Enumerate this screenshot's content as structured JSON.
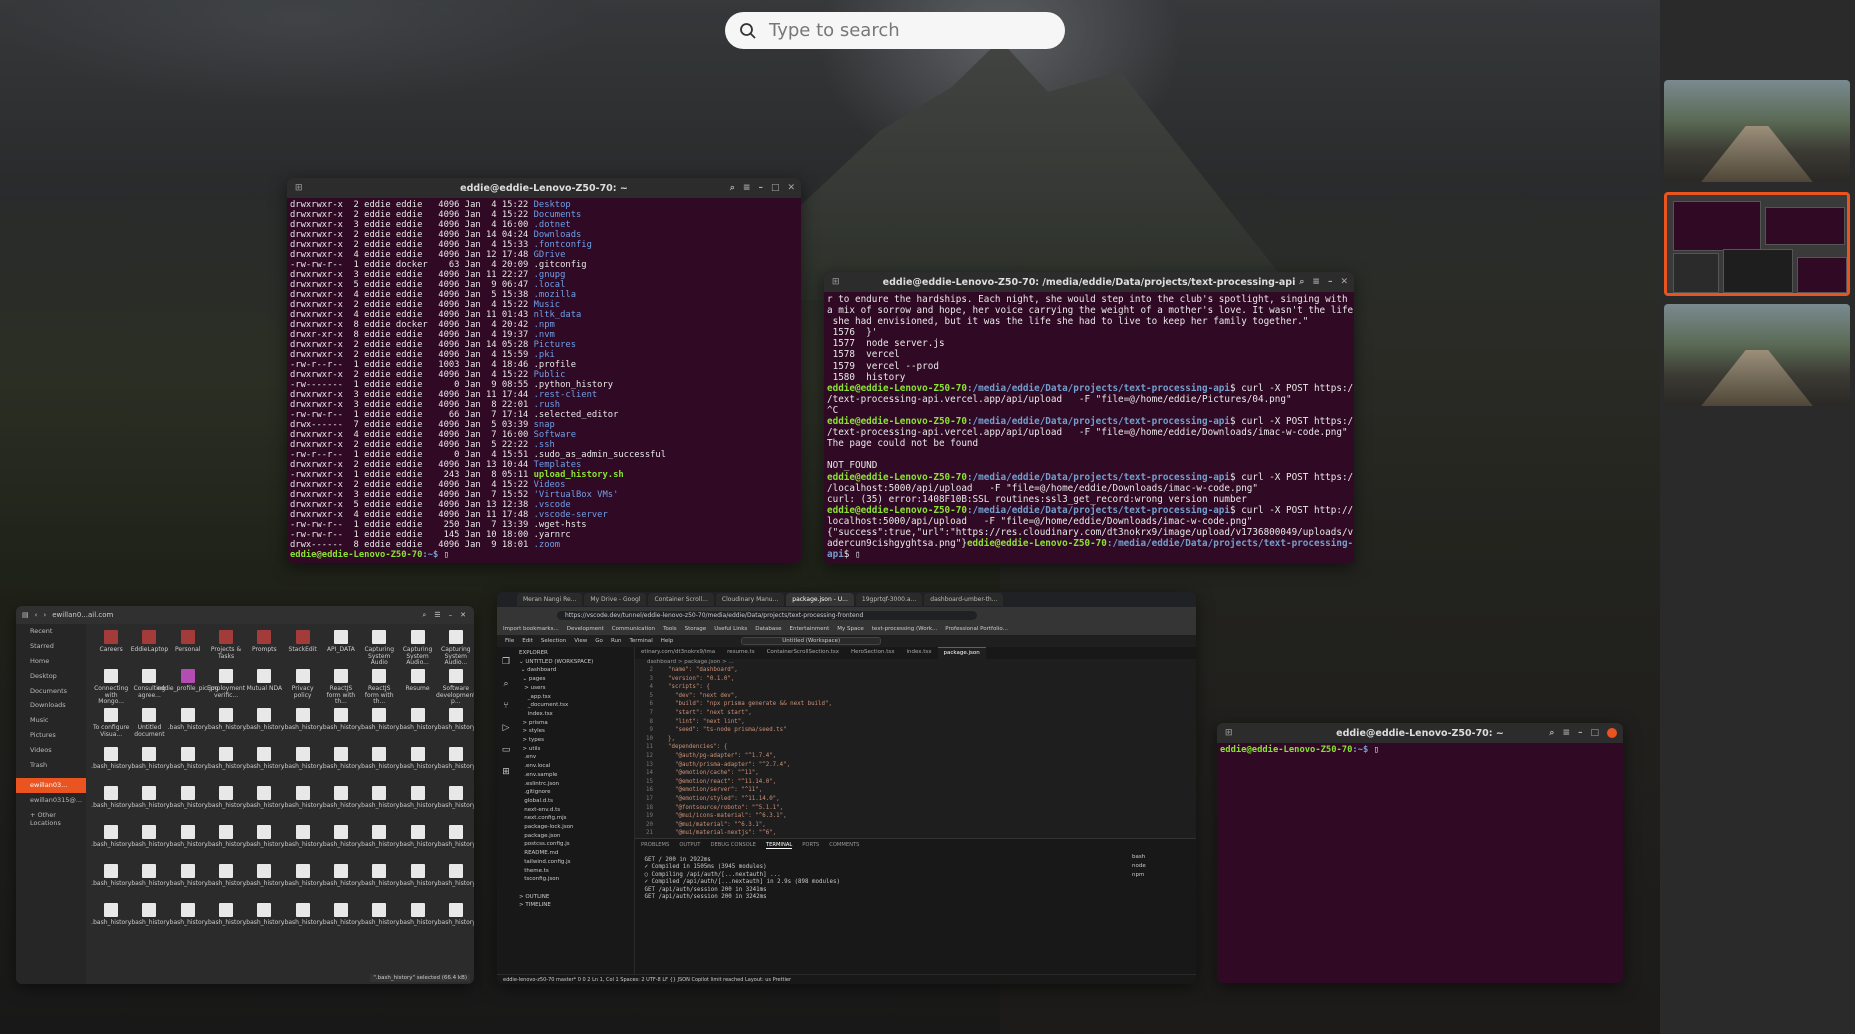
{
  "search": {
    "placeholder": "Type to search"
  },
  "term1": {
    "title": "eddie@eddie-Lenovo-Z50-70: ~",
    "lines": [
      [
        "drwxrwxr-x  2 eddie eddie   4096 Jan  4 15:22 ",
        "Desktop",
        "d"
      ],
      [
        "drwxrwxr-x  2 eddie eddie   4096 Jan  4 15:22 ",
        "Documents",
        "d"
      ],
      [
        "drwxrwxr-x  3 eddie eddie   4096 Jan  4 16:00 ",
        ".dotnet",
        "d"
      ],
      [
        "drwxrwxr-x  2 eddie eddie   4096 Jan 14 04:24 ",
        "Downloads",
        "d"
      ],
      [
        "drwxrwxr-x  2 eddie eddie   4096 Jan  4 15:33 ",
        ".fontconfig",
        "d"
      ],
      [
        "drwxrwxr-x  4 eddie eddie   4096 Jan 12 17:48 ",
        "GDrive",
        "d"
      ],
      [
        "-rw-rw-r--  1 eddie docker    63 Jan  4 20:09 ",
        ".gitconfig",
        "f"
      ],
      [
        "drwxrwxr-x  3 eddie eddie   4096 Jan 11 22:27 ",
        ".gnupg",
        "d"
      ],
      [
        "drwxrwxr-x  5 eddie eddie   4096 Jan  9 06:47 ",
        ".local",
        "d"
      ],
      [
        "drwxrwxr-x  4 eddie eddie   4096 Jan  5 15:38 ",
        ".mozilla",
        "d"
      ],
      [
        "drwxrwxr-x  2 eddie eddie   4096 Jan  4 15:22 ",
        "Music",
        "d"
      ],
      [
        "drwxrwxr-x  4 eddie eddie   4096 Jan 11 01:43 ",
        "nltk_data",
        "d"
      ],
      [
        "drwxrwxr-x  8 eddie docker  4096 Jan  4 20:42 ",
        ".npm",
        "d"
      ],
      [
        "drwxr-xr-x  8 eddie eddie   4096 Jan  4 19:37 ",
        ".nvm",
        "d"
      ],
      [
        "drwxrwxr-x  2 eddie eddie   4096 Jan 14 05:28 ",
        "Pictures",
        "d"
      ],
      [
        "drwxrwxr-x  2 eddie eddie   4096 Jan  4 15:59 ",
        ".pki",
        "d"
      ],
      [
        "-rw-r--r--  1 eddie eddie   1003 Jan  4 18:46 ",
        ".profile",
        "f"
      ],
      [
        "drwxrwxr-x  2 eddie eddie   4096 Jan  4 15:22 ",
        "Public",
        "d"
      ],
      [
        "-rw-------  1 eddie eddie      0 Jan  9 08:55 ",
        ".python_history",
        "f"
      ],
      [
        "drwxrwxr-x  3 eddie eddie   4096 Jan 11 17:44 ",
        ".rest-client",
        "d"
      ],
      [
        "drwxrwxr-x  3 eddie eddie   4096 Jan  8 22:01 ",
        ".rush",
        "d"
      ],
      [
        "-rw-rw-r--  1 eddie eddie     66 Jan  7 17:14 ",
        ".selected_editor",
        "f"
      ],
      [
        "drwx------  7 eddie eddie   4096 Jan  5 03:39 ",
        "snap",
        "d"
      ],
      [
        "drwxrwxr-x  4 eddie eddie   4096 Jan  7 16:00 ",
        "Software",
        "d"
      ],
      [
        "drwxrwxr-x  2 eddie eddie   4096 Jan  5 22:22 ",
        ".ssh",
        "d"
      ],
      [
        "-rw-r--r--  1 eddie eddie      0 Jan  4 15:51 ",
        ".sudo_as_admin_successful",
        "f"
      ],
      [
        "drwxrwxr-x  2 eddie eddie   4096 Jan 13 10:44 ",
        "Templates",
        "d"
      ],
      [
        "-rwxrwxr-x  1 eddie eddie    243 Jan  8 05:11 ",
        "upload_history.sh",
        "x"
      ],
      [
        "drwxrwxr-x  2 eddie eddie   4096 Jan  4 15:22 ",
        "Videos",
        "d"
      ],
      [
        "drwxrwxr-x  3 eddie eddie   4096 Jan  7 15:52 ",
        "'VirtualBox VMs'",
        "d"
      ],
      [
        "drwxrwxr-x  5 eddie eddie   4096 Jan 13 12:38 ",
        ".vscode",
        "d"
      ],
      [
        "drwxrwxr-x  4 eddie eddie   4096 Jan 11 17:48 ",
        ".vscode-server",
        "d"
      ],
      [
        "-rw-rw-r--  1 eddie eddie    250 Jan  7 13:39 ",
        ".wget-hsts",
        "f"
      ],
      [
        "-rw-rw-r--  1 eddie eddie    145 Jan 10 18:00 ",
        ".yarnrc",
        "f"
      ],
      [
        "drwx------  8 eddie eddie   4096 Jan  9 18:01 ",
        ".zoom",
        "d"
      ]
    ],
    "prompt": "eddie@eddie-Lenovo-Z50-70",
    "prompt_tail": ":~$ "
  },
  "term2": {
    "title": "eddie@eddie-Lenovo-Z50-70: /media/eddie/Data/projects/text-processing-api",
    "text_top": "r to endure the hardships. Each night, she would step into the club's spotlight, singing with\na mix of sorrow and hope, her voice carrying the weight of a mother's love. It wasn't the life\n she had envisioned, but it was the life she had to live to keep her family together.\"\n 1576  }'\n 1577  node server.js\n 1578  vercel\n 1579  vercel --prod\n 1580  history",
    "prompt_user": "eddie@eddie-Lenovo-Z50-70",
    "prompt_path": ":/media/eddie/Data/projects/text-processing-api",
    "cmd1": "$ curl -X POST https:/\n/text-processing-api.vercel.app/api/upload   -F \"file=@/home/eddie/Pictures/04.png\"\n^C",
    "cmd2": "$ curl -X POST https:/\n/text-processing-api.vercel.app/api/upload   -F \"file=@/home/eddie/Downloads/imac-w-code.png\"\nThe page could not be found\n\nNOT_FOUND",
    "cmd3": "$ curl -X POST https:/\n/localhost:5000/api/upload   -F \"file=@/home/eddie/Downloads/imac-w-code.png\"\ncurl: (35) error:1408F10B:SSL routines:ssl3_get_record:wrong version number",
    "cmd4": "$ curl -X POST http://\nlocalhost:5000/api/upload   -F \"file=@/home/eddie/Downloads/imac-w-code.png\"\n{\"success\":true,\"url\":\"https://res.cloudinary.com/dt3nokrx9/image/upload/v1736800049/uploads/v\nadercun9cishgyghtsa.png\"}",
    "prompt_path_end": ":/media/eddie/Data/projects/text-processing-\napi",
    "prompt_end": "$ "
  },
  "term3": {
    "title": "eddie@eddie-Lenovo-Z50-70: ~",
    "prompt": "eddie@eddie-Lenovo-Z50-70",
    "prompt_tail": ":~$ "
  },
  "files": {
    "title": "ewillan0...ail.com",
    "sidebar": [
      "Recent",
      "Starred",
      "Home",
      "Desktop",
      "Documents",
      "Downloads",
      "Music",
      "Pictures",
      "Videos",
      "Trash",
      "ewillan03...",
      "ewillan0315@...",
      "+ Other Locations"
    ],
    "items": [
      [
        "Careers",
        "folder"
      ],
      [
        "EddieLaptop",
        "folder"
      ],
      [
        "Personal",
        "folder"
      ],
      [
        "Projects & Tasks",
        "folder"
      ],
      [
        "Prompts",
        "folder"
      ],
      [
        "StackEdit",
        "folder"
      ],
      [
        "API_DATA",
        "doc"
      ],
      [
        "Capturing System Audio",
        "doc"
      ],
      [
        "Capturing System Audio...",
        "doc"
      ],
      [
        "Capturing System Audio...",
        "doc"
      ],
      [
        "Connecting with Mongo...",
        "doc"
      ],
      [
        "Consulting agree...",
        "doc"
      ],
      [
        "eddie_profile_pic.jpg",
        "pdoc"
      ],
      [
        "Employment verific...",
        "doc"
      ],
      [
        "Mutual NDA",
        "doc"
      ],
      [
        "Privacy policy",
        "doc"
      ],
      [
        "ReactJS form with th...",
        "doc"
      ],
      [
        "ReactJS form with th...",
        "doc"
      ],
      [
        "Resume",
        "doc"
      ],
      [
        "Software development p...",
        "doc"
      ],
      [
        "To configure Visua...",
        "doc"
      ],
      [
        "Untitled document",
        "doc"
      ],
      [
        ".bash_history",
        "doc"
      ],
      [
        ".bash_history",
        "doc"
      ],
      [
        ".bash_history",
        "doc"
      ],
      [
        ".bash_history",
        "doc"
      ],
      [
        ".bash_history",
        "doc"
      ],
      [
        ".bash_history",
        "doc"
      ],
      [
        ".bash_history",
        "doc"
      ],
      [
        ".bash_history",
        "doc"
      ],
      [
        ".bash_history",
        "doc"
      ],
      [
        ".bash_history",
        "doc"
      ],
      [
        ".bash_history",
        "doc"
      ],
      [
        ".bash_history",
        "doc"
      ],
      [
        ".bash_history",
        "doc"
      ],
      [
        ".bash_history",
        "doc"
      ],
      [
        ".bash_history",
        "doc"
      ],
      [
        ".bash_history",
        "doc"
      ],
      [
        ".bash_history",
        "doc"
      ],
      [
        ".bash_history",
        "doc"
      ],
      [
        ".bash_history",
        "doc"
      ],
      [
        ".bash_history",
        "doc"
      ],
      [
        ".bash_history",
        "doc"
      ],
      [
        ".bash_history",
        "doc"
      ],
      [
        ".bash_history",
        "doc"
      ],
      [
        ".bash_history",
        "doc"
      ],
      [
        ".bash_history",
        "doc"
      ],
      [
        ".bash_history",
        "doc"
      ],
      [
        ".bash_history",
        "doc"
      ],
      [
        ".bash_history",
        "doc"
      ],
      [
        ".bash_history",
        "doc"
      ],
      [
        ".bash_history",
        "doc"
      ],
      [
        ".bash_history",
        "doc"
      ],
      [
        ".bash_history",
        "doc"
      ],
      [
        ".bash_history",
        "doc"
      ],
      [
        ".bash_history",
        "doc"
      ],
      [
        ".bash_history",
        "doc"
      ],
      [
        ".bash_history",
        "doc"
      ],
      [
        ".bash_history",
        "doc"
      ],
      [
        ".bash_history",
        "doc"
      ],
      [
        ".bash_history",
        "doc"
      ],
      [
        ".bash_history",
        "doc"
      ],
      [
        ".bash_history",
        "doc"
      ],
      [
        ".bash_history",
        "doc"
      ],
      [
        ".bash_history",
        "doc"
      ],
      [
        ".bash_history",
        "doc"
      ],
      [
        ".bash_history",
        "doc"
      ],
      [
        ".bash_history",
        "doc"
      ],
      [
        ".bash_history",
        "doc"
      ],
      [
        ".bash_history",
        "doc"
      ],
      [
        ".bash_history",
        "doc"
      ],
      [
        ".bash_history",
        "doc"
      ],
      [
        ".bash_history",
        "doc"
      ],
      [
        ".bash_history",
        "doc"
      ],
      [
        ".bash_history",
        "doc"
      ],
      [
        ".bash_history",
        "doc"
      ],
      [
        ".bash_history",
        "doc"
      ],
      [
        ".bash_history",
        "doc"
      ],
      [
        ".bash_history",
        "doc"
      ],
      [
        ".bash_history",
        "doc"
      ]
    ],
    "status": "\".bash_history\" selected (66.4 kB)"
  },
  "vscode": {
    "tabs": [
      "Meran Nangi Re...",
      "My Drive - Googl",
      "Container Scroll...",
      "Cloudinary Manu...",
      "package.json - U...",
      "19gprtqf-3000.a...",
      "dashboard-umber-th..."
    ],
    "url": "https://vscode.dev/tunnel/eddie-lenovo-z50-70/media/eddie/Data/projects/text-processing-frontend",
    "bookmarks": [
      "Import bookmarks...",
      "Development",
      "Communication",
      "Tools",
      "Storage",
      "Useful Links",
      "Database",
      "Entertainment",
      "My Space",
      "text-processing (Work...",
      "Professional Portfolio..."
    ],
    "menu": [
      "File",
      "Edit",
      "Selection",
      "View",
      "Go",
      "Run",
      "Terminal",
      "Help"
    ],
    "workspace": "Untitled (Workspace)",
    "explorer": "EXPLORER\n⌄ UNTITLED (WORKSPACE)\n ⌄ dashboard\n  ⌄ pages\n   > users\n     _app.tsx\n     _document.tsx\n     index.tsx\n  > prisma\n  > styles\n  > types\n  > utils\n   .env\n   .env.local\n   .env.sample\n   .eslintrc.json\n   .gitignore\n   global.d.ts\n   next-env.d.ts\n   next.config.mjs\n   package-lock.json\n   package.json\n   postcss.config.js\n   README.md\n   tailwind.config.js\n   theme.ts\n   tsconfig.json\n\n> OUTLINE\n> TIMELINE",
    "edtabs": [
      "etinary.com/dt3nokrx9/ima",
      "resume.ts",
      "ContainerScrollSection.tsx",
      "HeroSection.tsx",
      "index.tsx",
      "package.json"
    ],
    "breadcrumb": "dashboard > package.json > ...",
    "code": [
      [
        "2",
        "  \"name\": \"dashboard\","
      ],
      [
        "3",
        "  \"version\": \"0.1.0\","
      ],
      [
        "4",
        "  \"scripts\": {"
      ],
      [
        "5",
        "    \"dev\": \"next dev\","
      ],
      [
        "6",
        "    \"build\": \"npx prisma generate && next build\","
      ],
      [
        "7",
        "    \"start\": \"next start\","
      ],
      [
        "8",
        "    \"lint\": \"next lint\","
      ],
      [
        "9",
        "    \"seed\": \"ts-node prisma/seed.ts\""
      ],
      [
        "10",
        "  },"
      ],
      [
        "11",
        "  \"dependencies\": {"
      ],
      [
        "12",
        "    \"@auth/pg-adapter\": \"^1.7.4\","
      ],
      [
        "13",
        "    \"@auth/prisma-adapter\": \"^2.7.4\","
      ],
      [
        "14",
        "    \"@emotion/cache\": \"^11\","
      ],
      [
        "15",
        "    \"@emotion/react\": \"^11.14.0\","
      ],
      [
        "16",
        "    \"@emotion/server\": \"^11\","
      ],
      [
        "17",
        "    \"@emotion/styled\": \"^11.14.0\","
      ],
      [
        "18",
        "    \"@fontsource/roboto\": \"^5.1.1\","
      ],
      [
        "19",
        "    \"@mui/icons-material\": \"^6.3.1\","
      ],
      [
        "20",
        "    \"@mui/material\": \"^6.3.1\","
      ],
      [
        "21",
        "    \"@mui/material-nextjs\": \"^6\","
      ]
    ],
    "ptabs": [
      "PROBLEMS",
      "OUTPUT",
      "DEBUG CONSOLE",
      "TERMINAL",
      "PORTS",
      "COMMENTS"
    ],
    "terminal": " GET / 200 in 2922ms\n ✓ Compiled in 1505ms (3945 modules)\n ○ Compiling /api/auth/[...nextauth] ...\n ✓ Compiled /api/auth/[...nextauth] in 2.9s (898 modules)\n GET /api/auth/session 200 in 3241ms\n GET /api/auth/session 200 in 3242ms",
    "terminal_list": [
      "bash",
      "node",
      "npm"
    ],
    "status": "eddie-lenovo-z50-70   master*   0 0   2        Ln 1, Col 1   Spaces: 2   UTF-8   LF   {} JSON   Copilot limit reached   Layout: us   Prettier"
  }
}
